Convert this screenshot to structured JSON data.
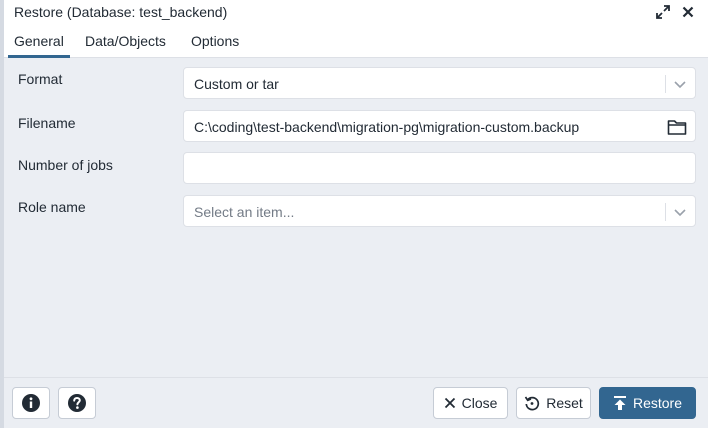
{
  "dialog": {
    "title": "Restore (Database: test_backend)"
  },
  "tabs": [
    {
      "label": "General",
      "active": true
    },
    {
      "label": "Data/Objects",
      "active": false
    },
    {
      "label": "Options",
      "active": false
    }
  ],
  "form": {
    "format": {
      "label": "Format",
      "value": "Custom or tar"
    },
    "filename": {
      "label": "Filename",
      "value": "C:\\coding\\test-backend\\migration-pg\\migration-custom.backup"
    },
    "jobs": {
      "label": "Number of jobs",
      "value": ""
    },
    "role": {
      "label": "Role name",
      "placeholder": "Select an item..."
    }
  },
  "footer": {
    "close_label": "Close",
    "reset_label": "Reset",
    "restore_label": "Restore"
  },
  "icons": {
    "maximize": "expand-icon",
    "close": "close-icon",
    "info": "info-icon",
    "help": "help-icon",
    "folder": "folder-icon"
  },
  "colors": {
    "accent": "#326690",
    "background": "#ebeef3",
    "border": "#dde0e6"
  }
}
